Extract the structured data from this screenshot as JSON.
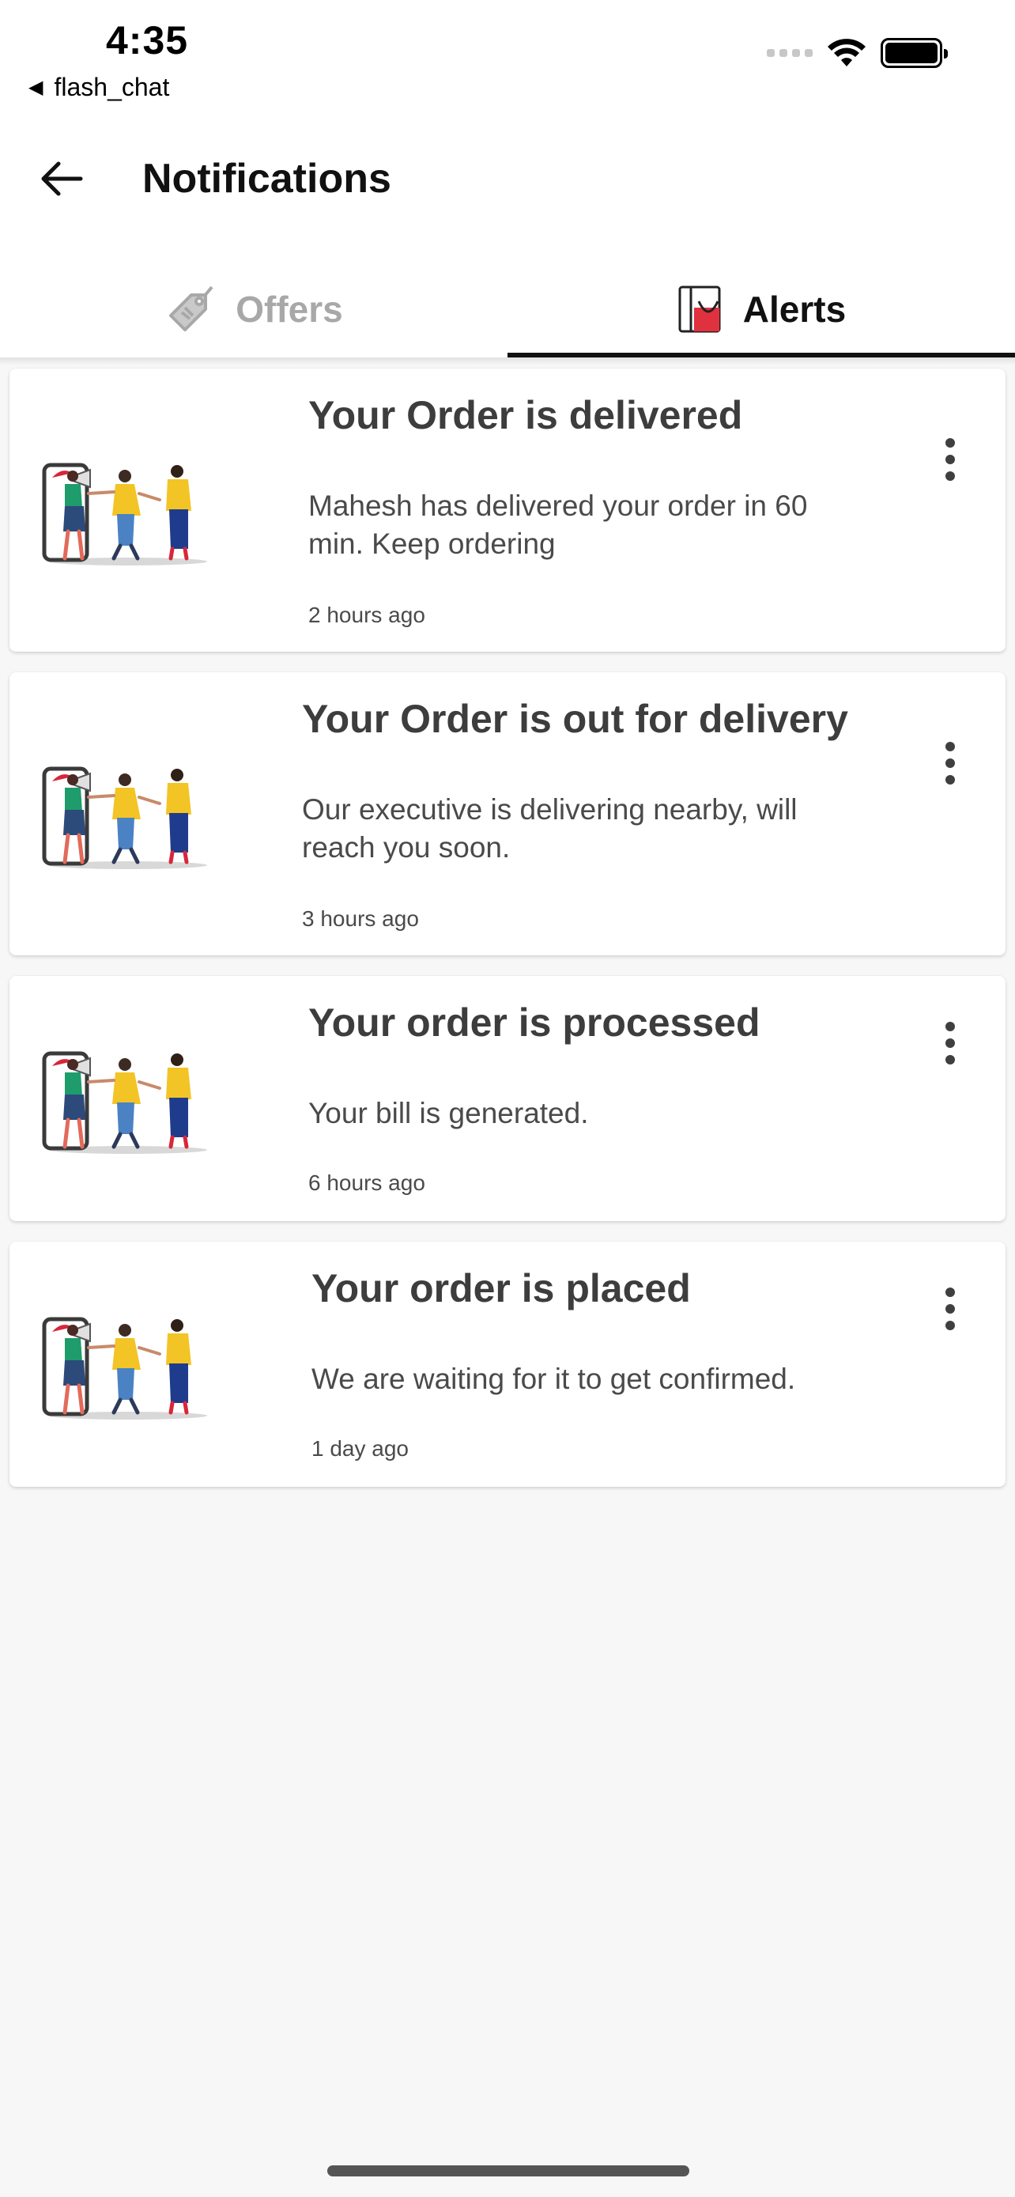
{
  "status_bar": {
    "time": "4:35",
    "back_app": "flash_chat"
  },
  "app_bar": {
    "title": "Notifications"
  },
  "tabs": [
    {
      "label": "Offers",
      "icon": "offers-tag-icon",
      "selected": false
    },
    {
      "label": "Alerts",
      "icon": "alerts-book-icon",
      "selected": true
    }
  ],
  "notifications": [
    {
      "title": "Your Order is delivered",
      "body": "Mahesh has delivered your order in 60\n min. Keep ordering",
      "time": "2 hours ago",
      "icon": "people-megaphone-illustration"
    },
    {
      "title": "Your Order is out for delivery",
      "body": "Our executive is delivering nearby, will\n reach you soon.",
      "time": "3 hours ago",
      "icon": "people-megaphone-illustration"
    },
    {
      "title": "Your order is processed",
      "body": "Your bill is generated.",
      "time": "6 hours ago",
      "icon": "people-megaphone-illustration"
    },
    {
      "title": "Your order is placed",
      "body": "We are waiting for it to get confirmed.",
      "time": "1 day ago",
      "icon": "people-megaphone-illustration"
    }
  ],
  "colors": {
    "accent": "#111111",
    "inactive_tab": "#a8a8a8",
    "background": "#f7f7f7"
  }
}
